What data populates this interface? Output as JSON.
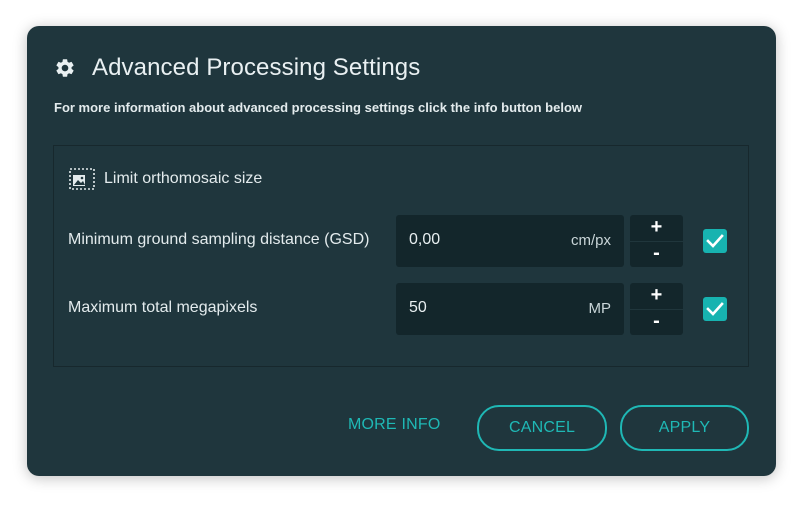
{
  "dialog": {
    "title": "Advanced Processing Settings",
    "subtitle": "For more information about advanced processing settings click the info button below",
    "icon": "gear-icon"
  },
  "section": {
    "label": "Limit orthomosaic size",
    "icon": "image-crop-icon"
  },
  "rows": [
    {
      "label": "Minimum ground sampling distance (GSD)",
      "value": "0,00",
      "unit": "cm/px",
      "plus": "+",
      "minus": "-",
      "checked": true
    },
    {
      "label": "Maximum total megapixels",
      "value": "50",
      "unit": "MP",
      "plus": "+",
      "minus": "-",
      "checked": true
    }
  ],
  "buttons": {
    "more_info": "MORE INFO",
    "cancel": "CANCEL",
    "apply": "APPLY"
  },
  "colors": {
    "background": "#1f363d",
    "input_background": "#13262b",
    "accent": "#1fb8b5",
    "checkbox": "#17b3b0",
    "text": "#e3ebed"
  }
}
